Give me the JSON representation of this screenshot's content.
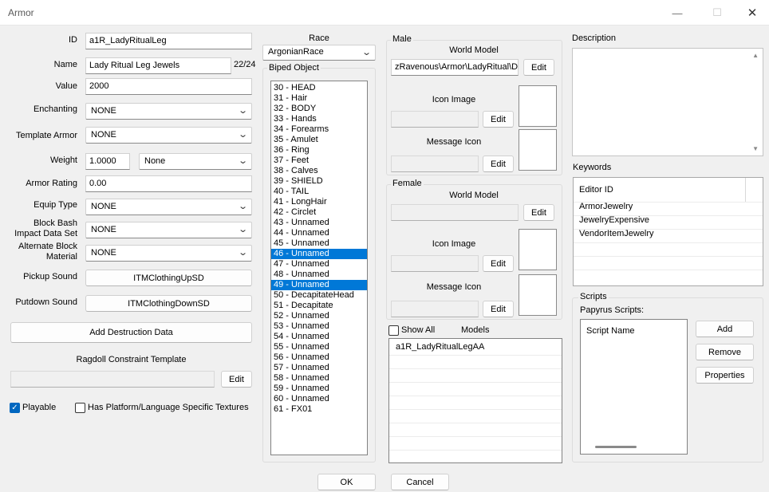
{
  "window": {
    "title": "Armor",
    "minimize": "—",
    "maximize": "☐",
    "close": "✕"
  },
  "form": {
    "id_label": "ID",
    "id_value": "a1R_LadyRitualLeg",
    "name_label": "Name",
    "name_value": "Lady Ritual Leg Jewels",
    "name_count": "22/24",
    "value_label": "Value",
    "value_value": "2000",
    "enchanting_label": "Enchanting",
    "enchanting_value": "NONE",
    "template_label": "Template Armor",
    "template_value": "NONE",
    "weight_label": "Weight",
    "weight_value": "1.0000",
    "weight_class": "None",
    "armor_rating_label": "Armor Rating",
    "armor_rating_value": "0.00",
    "equip_label": "Equip Type",
    "equip_value": "NONE",
    "block_bash_label_1": "Block Bash",
    "block_bash_label_2": "Impact Data Set",
    "block_bash_value": "NONE",
    "alt_block_label_1": "Alternate Block",
    "alt_block_label_2": "Material",
    "alt_block_value": "NONE",
    "pickup_label": "Pickup Sound",
    "pickup_value": "ITMClothingUpSD",
    "putdown_label": "Putdown Sound",
    "putdown_value": "ITMClothingDownSD",
    "add_destruction": "Add Destruction Data",
    "ragdoll_label": "Ragdoll Constraint Template",
    "ragdoll_value": "",
    "ragdoll_edit": "Edit",
    "playable_label": "Playable",
    "playable_checked": true,
    "platform_label": "Has Platform/Language Specific Textures",
    "platform_checked": false
  },
  "race": {
    "label": "Race",
    "value": "ArgonianRace"
  },
  "biped": {
    "label": "Biped Object",
    "items": [
      "30 - HEAD",
      "31 - Hair",
      "32 - BODY",
      "33 - Hands",
      "34 - Forearms",
      "35 - Amulet",
      "36 - Ring",
      "37 - Feet",
      "38 - Calves",
      "39 - SHIELD",
      "40 - TAIL",
      "41 - LongHair",
      "42 - Circlet",
      "43 - Unnamed",
      "44 - Unnamed",
      "45 - Unnamed",
      "46 - Unnamed",
      "47 - Unnamed",
      "48 - Unnamed",
      "49 - Unnamed",
      "50 - DecapitateHead",
      "51 - Decapitate",
      "52 - Unnamed",
      "53 - Unnamed",
      "54 - Unnamed",
      "55 - Unnamed",
      "56 - Unnamed",
      "57 - Unnamed",
      "58 - Unnamed",
      "59 - Unnamed",
      "60 - Unnamed",
      "61 - FX01"
    ],
    "selected": [
      16,
      19
    ]
  },
  "male": {
    "label": "Male",
    "world_model_label": "World Model",
    "world_model_value": "zRavenous\\Armor\\LadyRitual\\D",
    "world_edit": "Edit",
    "icon_label": "Icon Image",
    "icon_value": "",
    "icon_edit": "Edit",
    "message_label": "Message Icon",
    "message_value": "",
    "message_edit": "Edit"
  },
  "female": {
    "label": "Female",
    "world_model_label": "World Model",
    "world_model_value": "",
    "world_edit": "Edit",
    "icon_label": "Icon Image",
    "icon_value": "",
    "icon_edit": "Edit",
    "message_label": "Message Icon",
    "message_value": "",
    "message_edit": "Edit"
  },
  "models": {
    "show_all_label": "Show All",
    "show_all_checked": false,
    "label": "Models",
    "items": [
      "a1R_LadyRitualLegAA"
    ]
  },
  "description": {
    "label": "Description",
    "value": ""
  },
  "keywords": {
    "label": "Keywords",
    "header": "Editor ID",
    "items": [
      "ArmorJewelry",
      "JewelryExpensive",
      "VendorItemJewelry"
    ]
  },
  "scripts": {
    "label": "Scripts",
    "papyrus_label": "Papyrus Scripts:",
    "header": "Script Name",
    "add": "Add",
    "remove": "Remove",
    "properties": "Properties"
  },
  "footer": {
    "ok": "OK",
    "cancel": "Cancel"
  }
}
